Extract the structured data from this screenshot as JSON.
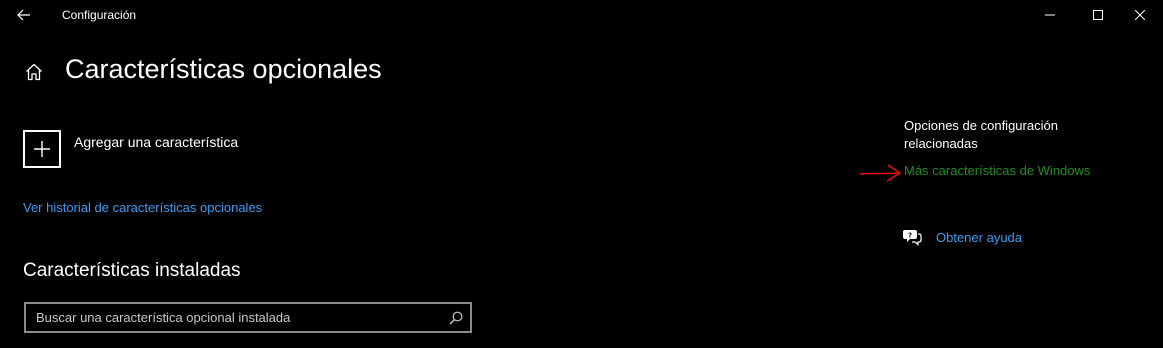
{
  "window": {
    "title": "Configuración",
    "back_icon": "back-arrow-icon",
    "controls": [
      "minimize-icon",
      "maximize-icon",
      "close-icon"
    ]
  },
  "header": {
    "home_icon": "home-icon",
    "title": "Características opcionales"
  },
  "main": {
    "add_feature_icon": "plus-icon",
    "add_feature_label": "Agregar una característica",
    "history_link": "Ver historial de características opcionales",
    "installed_title": "Características instaladas",
    "search": {
      "placeholder": "Buscar una característica opcional instalada",
      "value": "",
      "icon": "search-icon"
    }
  },
  "related": {
    "title": "Opciones de configuración relacionadas",
    "more_features_link": "Más características de Windows",
    "help_icon": "help-chat-icon",
    "help_link": "Obtener ayuda"
  },
  "colors": {
    "background": "#000000",
    "link_blue": "#3b9cf0",
    "highlight_green": "#1f8f1f",
    "annotation_red": "#e81010"
  }
}
